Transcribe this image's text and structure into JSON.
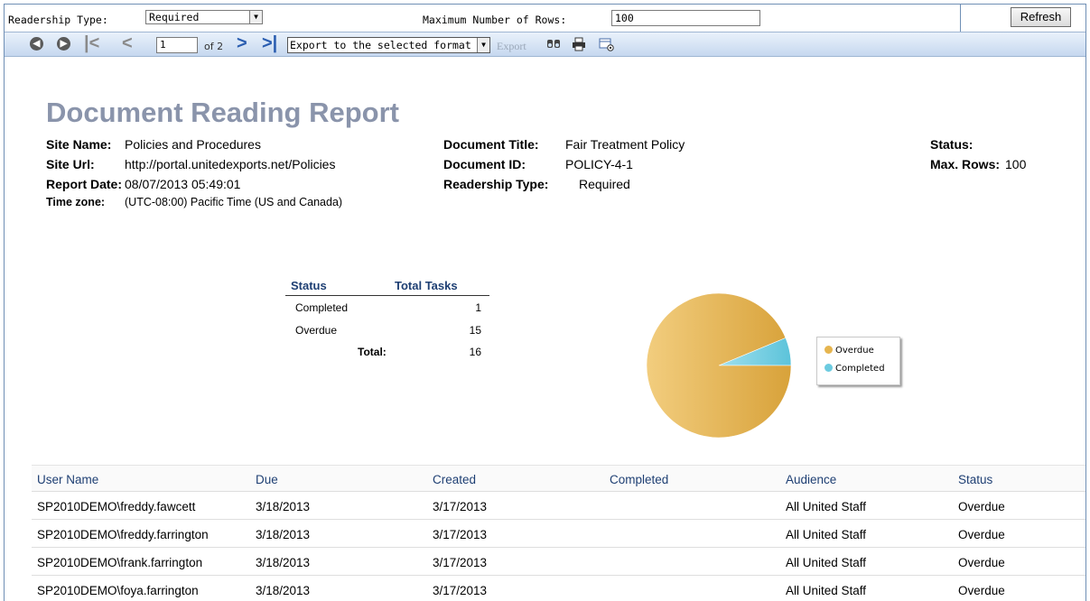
{
  "params": {
    "readership_type_label": "Readership Type:",
    "readership_type_value": "Required",
    "max_rows_label": "Maximum Number of Rows:",
    "max_rows_value": "100",
    "refresh_label": "Refresh"
  },
  "toolbar": {
    "page_value": "1",
    "page_of": "of 2",
    "export_format": "Export to the selected format",
    "export_label": "Export",
    "icons": [
      "back-icon",
      "forward-icon",
      "first-page-icon",
      "previous-page-icon",
      "next-page-icon",
      "last-page-icon",
      "find-icon",
      "print-icon",
      "email-icon"
    ]
  },
  "report": {
    "title": "Document Reading Report",
    "site_name_label": "Site Name:",
    "site_name": "Policies and Procedures",
    "site_url_label": "Site Url:",
    "site_url": "http://portal.unitedexports.net/Policies",
    "report_date_label": "Report Date:",
    "report_date": "08/07/2013 05:49:01",
    "time_zone_label": "Time zone:",
    "time_zone": "(UTC-08:00) Pacific Time (US and Canada)",
    "doc_title_label": "Document Title:",
    "doc_title": "Fair Treatment Policy",
    "doc_id_label": "Document ID:",
    "doc_id": "POLICY-4-1",
    "readership_label": "Readership Type:",
    "readership": "Required",
    "status_label": "Status:",
    "max_rows_label": "Max. Rows:",
    "max_rows": "100"
  },
  "summary": {
    "status_header": "Status",
    "total_header": "Total Tasks",
    "rows": [
      {
        "status": "Completed",
        "count": "1"
      },
      {
        "status": "Overdue",
        "count": "15"
      }
    ],
    "total_label": "Total:",
    "total_value": "16"
  },
  "chart_data": {
    "type": "pie",
    "slices": [
      {
        "label": "Overdue",
        "value": 15,
        "color": "#e6b54f"
      },
      {
        "label": "Completed",
        "value": 1,
        "color": "#6ccbe0"
      }
    ],
    "legend": [
      "Overdue",
      "Completed"
    ],
    "legend_position": "right"
  },
  "detail": {
    "headers": [
      "User Name",
      "Due",
      "Created",
      "Completed",
      "Audience",
      "Status"
    ],
    "rows": [
      [
        "SP2010DEMO\\freddy.fawcett",
        "3/18/2013",
        "3/17/2013",
        "",
        "All United Staff",
        "Overdue"
      ],
      [
        "SP2010DEMO\\freddy.farrington",
        "3/18/2013",
        "3/17/2013",
        "",
        "All United Staff",
        "Overdue"
      ],
      [
        "SP2010DEMO\\frank.farrington",
        "3/18/2013",
        "3/17/2013",
        "",
        "All United Staff",
        "Overdue"
      ],
      [
        "SP2010DEMO\\foya.farrington",
        "3/18/2013",
        "3/17/2013",
        "",
        "All United Staff",
        "Overdue"
      ]
    ]
  }
}
